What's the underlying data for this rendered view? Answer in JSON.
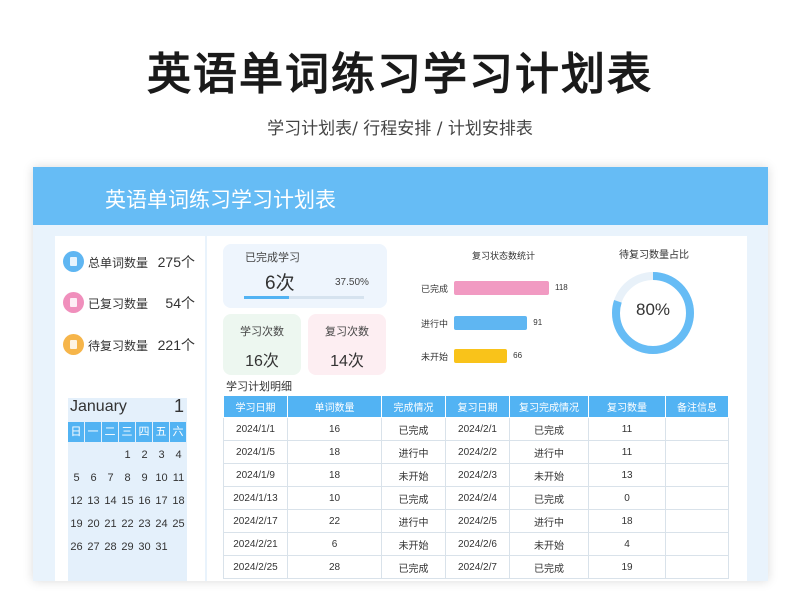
{
  "page": {
    "title": "英语单词练习学习计划表",
    "subtitle": "学习计划表/ 行程安排 / 计划安排表"
  },
  "sheet": {
    "banner_title": "英语单词练习学习计划表",
    "stats": [
      {
        "label": "总单词数量",
        "value": "275个",
        "color": "#5fb6f2",
        "icon": "book-icon"
      },
      {
        "label": "已复习数量",
        "value": "54个",
        "color": "#f08fbc",
        "icon": "book-icon"
      },
      {
        "label": "待复习数量",
        "value": "221个",
        "color": "#f6b54a",
        "icon": "book-icon"
      }
    ],
    "calendar": {
      "month": "January",
      "day": "1",
      "weekdays": [
        "日",
        "一",
        "二",
        "三",
        "四",
        "五",
        "六"
      ],
      "days": [
        "",
        "",
        "",
        "1",
        "2",
        "3",
        "4",
        "5",
        "6",
        "7",
        "8",
        "9",
        "10",
        "11",
        "12",
        "13",
        "14",
        "15",
        "16",
        "17",
        "18",
        "19",
        "20",
        "21",
        "22",
        "23",
        "24",
        "25",
        "26",
        "27",
        "28",
        "29",
        "30",
        "31",
        ""
      ]
    },
    "done_card": {
      "label": "已完成学习",
      "value": "6次",
      "percent_text": "37.50%",
      "percent": 37.5
    },
    "study_card": {
      "label": "学习次数",
      "value": "16次"
    },
    "review_card": {
      "label": "复习次数",
      "value": "14次"
    },
    "bar_chart": {
      "title": "复习状态数统计",
      "max": 118,
      "bars": [
        {
          "label": "已完成",
          "value": 118,
          "display": "118",
          "color": "#f19ac2"
        },
        {
          "label": "进行中",
          "value": 91,
          "display": "91",
          "color": "#5fb6f2"
        },
        {
          "label": "未开始",
          "value": 66,
          "display": "66",
          "color": "#f9c31a"
        }
      ]
    },
    "donut": {
      "title": "待复习数量占比",
      "percent": 80,
      "text": "80%",
      "color": "#66bcf5",
      "track": "#e8f1f9"
    },
    "detail": {
      "label": "学习计划明细",
      "headers": [
        "学习日期",
        "单词数量",
        "完成情况",
        "复习日期",
        "复习完成情况",
        "复习数量",
        "备注信息"
      ],
      "rows": [
        [
          "2024/1/1",
          "16",
          "已完成",
          "2024/2/1",
          "已完成",
          "11",
          ""
        ],
        [
          "2024/1/5",
          "18",
          "进行中",
          "2024/2/2",
          "进行中",
          "11",
          ""
        ],
        [
          "2024/1/9",
          "18",
          "未开始",
          "2024/2/3",
          "未开始",
          "13",
          ""
        ],
        [
          "2024/1/13",
          "10",
          "已完成",
          "2024/2/4",
          "已完成",
          "0",
          ""
        ],
        [
          "2024/2/17",
          "22",
          "进行中",
          "2024/2/5",
          "进行中",
          "18",
          ""
        ],
        [
          "2024/2/21",
          "6",
          "未开始",
          "2024/2/6",
          "未开始",
          "4",
          ""
        ],
        [
          "2024/2/25",
          "28",
          "已完成",
          "2024/2/7",
          "已完成",
          "19",
          ""
        ]
      ]
    }
  }
}
